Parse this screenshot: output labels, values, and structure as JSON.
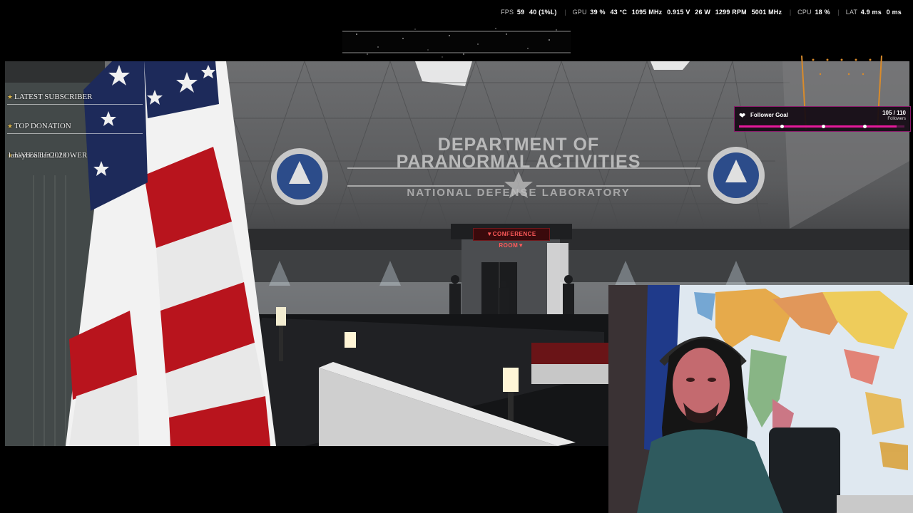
{
  "perf": {
    "fps_label": "FPS",
    "fps": "59",
    "fps_low": "40 (1%L)",
    "gpu_label": "GPU",
    "gpu_load": "39 %",
    "gpu_temp": "43 °C",
    "gpu_clock": "1095 MHz",
    "gpu_volt": "0.915 V",
    "gpu_power": "26 W",
    "gpu_fan": "1299 RPM",
    "gpu_mem": "5001 MHz",
    "cpu_label": "CPU",
    "cpu_load": "18 %",
    "lat_label": "LAT",
    "lat_1": "4.9 ms",
    "lat_2": "0 ms"
  },
  "stream": {
    "latest_subscriber_label": "LATEST SUBSCRIBER",
    "top_donation_label": "TOP DONATION",
    "latest_follower_label": "LATEST FOLLOWER",
    "latest_follower_value": "lankyboaldan2020"
  },
  "game": {
    "sign_line1": "DEPARTMENT OF",
    "sign_line2": "PARANORMAL ACTIVITIES",
    "sign_line3": "NATIONAL DEFENSE LABORATORY",
    "conference_sign": "▼CONFERENCE ROOM▼"
  },
  "follower_goal": {
    "title": "Follower Goal",
    "count": "105 / 110",
    "unit": "Followers",
    "progress": 0.9545,
    "accent": "#e5199b"
  },
  "icons": [
    "star-icon",
    "heart-icon"
  ]
}
